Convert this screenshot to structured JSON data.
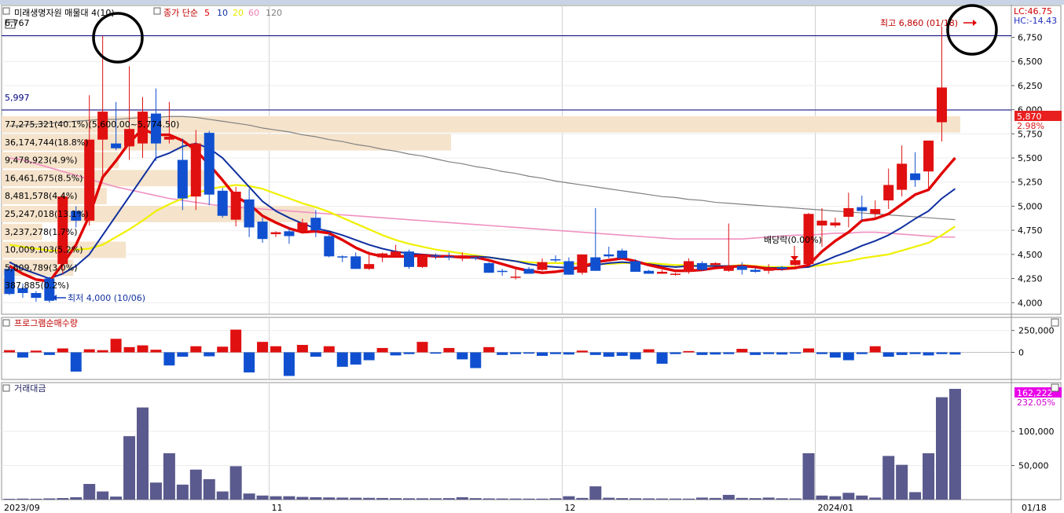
{
  "header": {
    "stock_label": "미래생명자원 매물대 4(10)",
    "ma_label": "종가 단순",
    "ma_periods": [
      "5",
      "10",
      "20",
      "60",
      "120"
    ],
    "ma_colors": [
      "#e00000",
      "#1030a0",
      "#e8e800",
      "#f080b0",
      "#808080"
    ]
  },
  "right_info": {
    "lc": "LC:46.75",
    "hc": "HC:-14.43",
    "current_price": "5,870",
    "current_change": "2.98%",
    "volume_current": "162,222",
    "volume_change": "232.05%"
  },
  "annotations": {
    "high": "최고 6,860 (01/18)",
    "low": "최저 4,000 (10/06)",
    "dividend": "배당락(0.00%)",
    "left_top_price": "6,767",
    "hline_price": "5,997"
  },
  "panels": {
    "program": "프로그램순매수량",
    "amount": "거래대금"
  },
  "volume_profile": [
    {
      "label": "77,275,321(40.1%)(5,600,00~5,774.50)",
      "value": 40.1
    },
    {
      "label": "36,174,744(18.8%)",
      "value": 18.8
    },
    {
      "label": "9,478,923(4.9%)",
      "value": 4.9
    },
    {
      "label": "16,461,675(8.5%)",
      "value": 8.5
    },
    {
      "label": "8,481,578(4.4%)",
      "value": 4.4
    },
    {
      "label": "25,247,018(13.1%)",
      "value": 13.1
    },
    {
      "label": "3,237,278(1.7%)",
      "value": 1.7
    },
    {
      "label": "10,009,103(5.2%)",
      "value": 5.2
    },
    {
      "label": "5,609,789(3.0%)",
      "value": 3.0
    },
    {
      "label": "387,885(0.2%)",
      "value": 0.2
    }
  ],
  "chart_data": {
    "type": "candlestick",
    "x_ticks": [
      {
        "label": "2023/09",
        "index": 0
      },
      {
        "label": "11",
        "index": 20
      },
      {
        "label": "12",
        "index": 42
      },
      {
        "label": "2024/01",
        "index": 61
      },
      {
        "label": "01/18",
        "index": 73
      }
    ],
    "price_axis": {
      "ticks": [
        4000,
        4250,
        4500,
        4750,
        5000,
        5250,
        5500,
        5750,
        6000,
        6250,
        6500,
        6750
      ],
      "ylim": [
        3880,
        7080
      ]
    },
    "program_axis": {
      "ticks": [
        0,
        250000
      ],
      "ylim": [
        -310000,
        400000
      ]
    },
    "amount_axis": {
      "ticks": [
        50000,
        100000
      ],
      "ylim": [
        0,
        162222
      ]
    },
    "hlines": [
      6767,
      5997
    ],
    "candles": [
      [
        4350,
        4380,
        4080,
        4090
      ],
      [
        4150,
        4200,
        4050,
        4100
      ],
      [
        4100,
        4120,
        4010,
        4050
      ],
      [
        4250,
        4270,
        4000,
        4020
      ],
      [
        4400,
        5130,
        4300,
        5100
      ],
      [
        4950,
        5000,
        4780,
        4850
      ],
      [
        4850,
        6150,
        4800,
        5690
      ],
      [
        5690,
        6767,
        5300,
        5980
      ],
      [
        5650,
        6080,
        5580,
        5600
      ],
      [
        5620,
        6450,
        5480,
        5800
      ],
      [
        5650,
        6130,
        5500,
        5980
      ],
      [
        5960,
        6220,
        5470,
        5650
      ],
      [
        5690,
        6080,
        5650,
        5720
      ],
      [
        5480,
        5700,
        4960,
        5080
      ],
      [
        5100,
        5790,
        4960,
        5650
      ],
      [
        5760,
        5780,
        5010,
        5120
      ],
      [
        5160,
        5190,
        4880,
        4900
      ],
      [
        4860,
        5200,
        4790,
        5150
      ],
      [
        5070,
        5180,
        4680,
        4780
      ],
      [
        4840,
        4880,
        4620,
        4660
      ],
      [
        4710,
        4740,
        4680,
        4730
      ],
      [
        4740,
        4770,
        4610,
        4690
      ],
      [
        4740,
        4870,
        4730,
        4830
      ],
      [
        4880,
        4960,
        4680,
        4750
      ],
      [
        4690,
        4720,
        4470,
        4480
      ],
      [
        4480,
        4490,
        4420,
        4470
      ],
      [
        4480,
        4520,
        4350,
        4350
      ],
      [
        4350,
        4530,
        4340,
        4400
      ],
      [
        4470,
        4520,
        4420,
        4510
      ],
      [
        4480,
        4600,
        4470,
        4530
      ],
      [
        4530,
        4550,
        4350,
        4370
      ],
      [
        4370,
        4500,
        4360,
        4490
      ],
      [
        4490,
        4510,
        4450,
        4480
      ],
      [
        4480,
        4520,
        4440,
        4470
      ],
      [
        4460,
        4520,
        4430,
        4490
      ],
      [
        4470,
        4480,
        4440,
        4460
      ],
      [
        4410,
        4420,
        4310,
        4310
      ],
      [
        4330,
        4350,
        4280,
        4320
      ],
      [
        4270,
        4360,
        4240,
        4270
      ],
      [
        4350,
        4370,
        4300,
        4300
      ],
      [
        4340,
        4460,
        4330,
        4420
      ],
      [
        4450,
        4490,
        4420,
        4440
      ],
      [
        4430,
        4470,
        4290,
        4290
      ],
      [
        4310,
        4500,
        4290,
        4500
      ],
      [
        4470,
        4980,
        4330,
        4330
      ],
      [
        4500,
        4580,
        4460,
        4480
      ],
      [
        4540,
        4560,
        4460,
        4460
      ],
      [
        4430,
        4450,
        4320,
        4320
      ],
      [
        4330,
        4340,
        4300,
        4300
      ],
      [
        4300,
        4340,
        4300,
        4320
      ],
      [
        4290,
        4310,
        4280,
        4300
      ],
      [
        4320,
        4460,
        4300,
        4430
      ],
      [
        4410,
        4430,
        4330,
        4340
      ],
      [
        4390,
        4420,
        4380,
        4410
      ],
      [
        4330,
        4820,
        4320,
        4380
      ],
      [
        4380,
        4420,
        4290,
        4340
      ],
      [
        4340,
        4360,
        4310,
        4320
      ],
      [
        4330,
        4400,
        4300,
        4360
      ],
      [
        4370,
        4380,
        4330,
        4350
      ],
      [
        4390,
        4460,
        4380,
        4440
      ],
      [
        4400,
        4930,
        4380,
        4920
      ],
      [
        4800,
        4980,
        4580,
        4850
      ],
      [
        4800,
        4880,
        4780,
        4830
      ],
      [
        4890,
        5140,
        4780,
        4980
      ],
      [
        4990,
        5110,
        4850,
        4950
      ],
      [
        4920,
        5060,
        4880,
        4970
      ],
      [
        5060,
        5390,
        4970,
        5220
      ],
      [
        5170,
        5630,
        5100,
        5440
      ],
      [
        5340,
        5560,
        5200,
        5270
      ],
      [
        5360,
        5640,
        5180,
        5680
      ],
      [
        5870,
        6860,
        5670,
        6230
      ]
    ],
    "ma5": [
      4380,
      4300,
      4240,
      4220,
      4400,
      4600,
      4900,
      5300,
      5470,
      5660,
      5800,
      5740,
      5740,
      5680,
      5580,
      5430,
      5270,
      5100,
      5020,
      4900,
      4830,
      4770,
      4730,
      4740,
      4720,
      4650,
      4570,
      4510,
      4480,
      4480,
      4480,
      4490,
      4480,
      4480,
      4470,
      4470,
      4440,
      4400,
      4360,
      4330,
      4310,
      4320,
      4340,
      4370,
      4420,
      4440,
      4460,
      4430,
      4390,
      4360,
      4330,
      4330,
      4340,
      4360,
      4370,
      4380,
      4370,
      4350,
      4350,
      4360,
      4390,
      4530,
      4640,
      4730,
      4850,
      4870,
      4920,
      5020,
      5120,
      5170,
      5340,
      5500
    ],
    "ma10": [
      4420,
      4350,
      4300,
      4250,
      4300,
      4380,
      4500,
      4700,
      4900,
      5100,
      5300,
      5500,
      5550,
      5620,
      5650,
      5600,
      5500,
      5350,
      5200,
      5050,
      4950,
      4880,
      4820,
      4770,
      4740,
      4700,
      4650,
      4600,
      4560,
      4530,
      4510,
      4500,
      4490,
      4480,
      4480,
      4480,
      4470,
      4450,
      4430,
      4400,
      4380,
      4370,
      4360,
      4370,
      4390,
      4410,
      4420,
      4410,
      4400,
      4380,
      4370,
      4380,
      4380,
      4380,
      4380,
      4380,
      4370,
      4360,
      4360,
      4360,
      4370,
      4420,
      4480,
      4530,
      4590,
      4640,
      4700,
      4780,
      4870,
      4950,
      5080,
      5180
    ],
    "ma20": [
      4600,
      4580,
      4560,
      4540,
      4540,
      4550,
      4560,
      4600,
      4680,
      4760,
      4850,
      4950,
      5020,
      5080,
      5130,
      5180,
      5200,
      5220,
      5210,
      5180,
      5130,
      5080,
      5030,
      4990,
      4940,
      4880,
      4820,
      4760,
      4700,
      4650,
      4610,
      4580,
      4550,
      4530,
      4510,
      4490,
      4470,
      4450,
      4430,
      4420,
      4410,
      4410,
      4410,
      4400,
      4400,
      4400,
      4410,
      4410,
      4410,
      4400,
      4390,
      4390,
      4380,
      4380,
      4380,
      4390,
      4380,
      4370,
      4370,
      4370,
      4370,
      4390,
      4410,
      4430,
      4460,
      4480,
      4500,
      4540,
      4580,
      4620,
      4700,
      4790
    ],
    "ma60": [
      5500,
      5480,
      5440,
      5400,
      5360,
      5320,
      5280,
      5240,
      5200,
      5170,
      5140,
      5110,
      5080,
      5060,
      5040,
      5020,
      5000,
      4990,
      4980,
      4970,
      4960,
      4950,
      4940,
      4930,
      4920,
      4910,
      4900,
      4890,
      4880,
      4870,
      4860,
      4850,
      4840,
      4830,
      4820,
      4810,
      4800,
      4790,
      4780,
      4770,
      4760,
      4750,
      4740,
      4730,
      4720,
      4710,
      4700,
      4690,
      4680,
      4670,
      4660,
      4660,
      4660,
      4660,
      4660,
      4660,
      4670,
      4680,
      4690,
      4700,
      4700,
      4710,
      4720,
      4720,
      4730,
      4730,
      4720,
      4710,
      4700,
      4690,
      4680,
      4680
    ],
    "ma120": [
      5830,
      5840,
      5850,
      5860,
      5870,
      5880,
      5890,
      5900,
      5900,
      5910,
      5920,
      5920,
      5930,
      5930,
      5920,
      5900,
      5880,
      5860,
      5840,
      5810,
      5790,
      5770,
      5740,
      5720,
      5690,
      5670,
      5640,
      5620,
      5590,
      5570,
      5540,
      5520,
      5490,
      5460,
      5440,
      5410,
      5390,
      5360,
      5340,
      5310,
      5290,
      5260,
      5240,
      5220,
      5200,
      5180,
      5160,
      5140,
      5120,
      5100,
      5090,
      5070,
      5060,
      5040,
      5030,
      5020,
      5010,
      5000,
      4990,
      4980,
      4970,
      4960,
      4950,
      4940,
      4930,
      4920,
      4910,
      4900,
      4890,
      4880,
      4870,
      4860
    ],
    "program": [
      25000,
      -60000,
      20000,
      -30000,
      45000,
      -220000,
      35000,
      25000,
      155000,
      60000,
      80000,
      30000,
      -150000,
      -50000,
      70000,
      -45000,
      65000,
      260000,
      -230000,
      120000,
      70000,
      -270000,
      85000,
      -50000,
      70000,
      -165000,
      -140000,
      -90000,
      50000,
      -35000,
      -20000,
      120000,
      -15000,
      50000,
      -80000,
      -180000,
      60000,
      -30000,
      -20000,
      -15000,
      -40000,
      -20000,
      -25000,
      20000,
      -30000,
      -50000,
      -40000,
      -80000,
      35000,
      -130000,
      -20000,
      15000,
      -30000,
      -25000,
      -20000,
      40000,
      -30000,
      -20000,
      -25000,
      -15000,
      45000,
      -20000,
      -60000,
      -90000,
      -20000,
      70000,
      -50000,
      -30000,
      -20000,
      -35000,
      -20000,
      -25000
    ],
    "amount": [
      1200,
      1500,
      1300,
      1800,
      2300,
      3500,
      23000,
      12000,
      4500,
      93000,
      135000,
      25000,
      68000,
      22000,
      44000,
      30000,
      12000,
      49000,
      9000,
      6000,
      5000,
      5000,
      4000,
      3500,
      3200,
      3000,
      2800,
      2600,
      2400,
      2200,
      2000,
      2000,
      2000,
      2200,
      3500,
      2200,
      1800,
      1700,
      1600,
      1500,
      1500,
      2000,
      5000,
      2500,
      19500,
      2800,
      2200,
      2000,
      1800,
      1700,
      1600,
      1500,
      3000,
      2500,
      7000,
      2500,
      2200,
      3000,
      2000,
      1800,
      68000,
      6000,
      5000,
      10000,
      6000,
      3000,
      64000,
      51000,
      11000,
      68000,
      150000,
      162222
    ]
  }
}
